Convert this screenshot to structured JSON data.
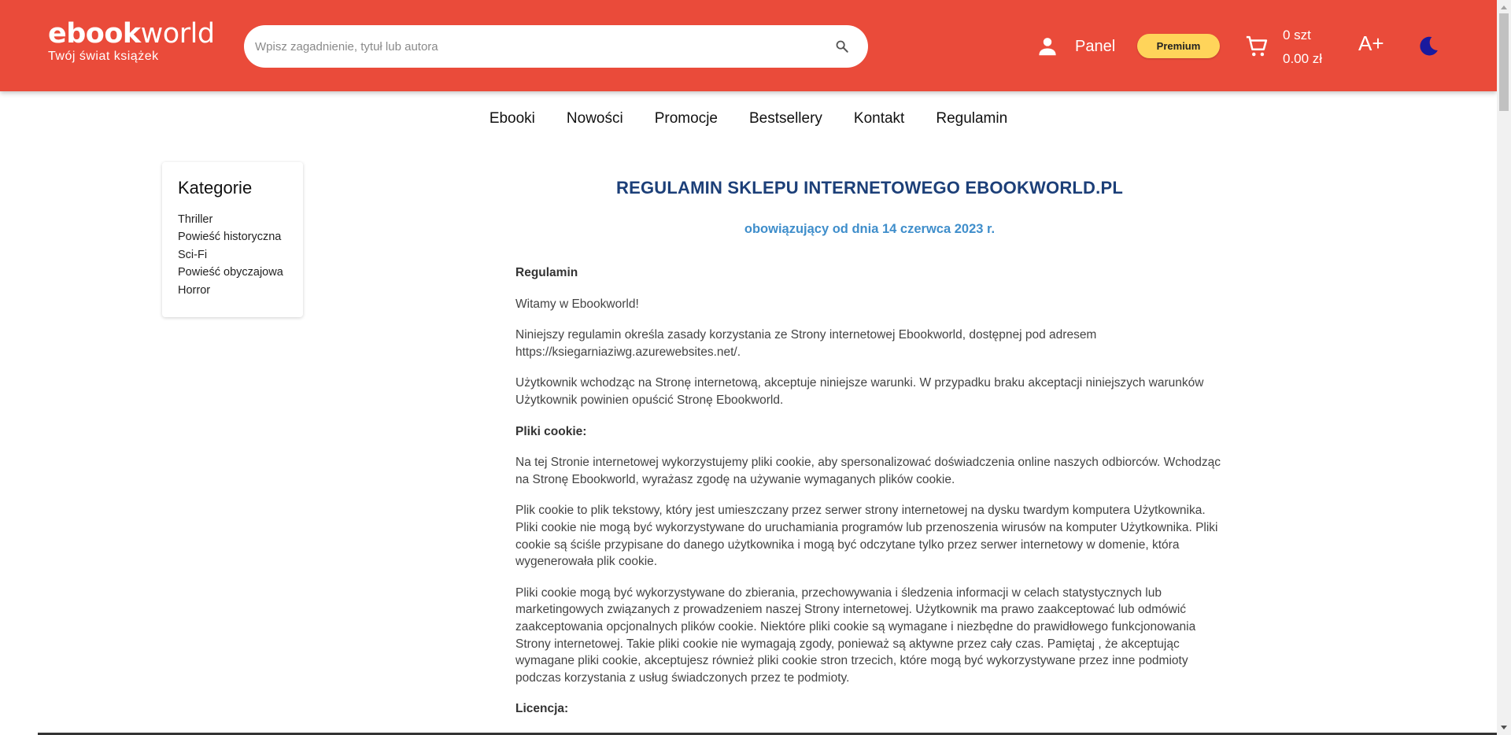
{
  "header": {
    "logo_bold": "ebook",
    "logo_light": "world",
    "tagline": "Twój świat książek",
    "search_placeholder": "Wpisz zagadnienie, tytuł lub autora",
    "panel_label": "Panel",
    "premium_label": "Premium",
    "cart_count": "0 szt",
    "cart_total": "0.00 zł",
    "font_size_label": "A+",
    "colors": {
      "bar": "#ea4b3a",
      "premium": "#ffd45a",
      "theme_icon": "#1a1a9e"
    },
    "icons": [
      "search-icon",
      "user-icon",
      "cart-icon",
      "moon-icon"
    ]
  },
  "nav": {
    "items": [
      "Ebooki",
      "Nowości",
      "Promocje",
      "Bestsellery",
      "Kontakt",
      "Regulamin"
    ]
  },
  "sidebar": {
    "title": "Kategorie",
    "items": [
      "Thriller",
      "Powieść historyczna",
      "Sci-Fi",
      "Powieść obyczajowa",
      "Horror"
    ]
  },
  "document": {
    "title": "REGULAMIN SKLEPU INTERNETOWEGO EBOOKWORLD.PL",
    "subtitle": "obowiązujący od dnia 14 czerwca 2023 r.",
    "paragraphs": [
      {
        "heading": true,
        "text": "Regulamin"
      },
      {
        "heading": false,
        "text": "Witamy w Ebookworld!"
      },
      {
        "heading": false,
        "text": "Niniejszy regulamin określa zasady korzystania ze Strony internetowej Ebookworld, dostępnej pod adresem https://ksiegarniaziwg.azurewebsites.net/."
      },
      {
        "heading": false,
        "text": "Użytkownik wchodząc na Stronę internetową, akceptuje niniejsze warunki. W przypadku braku akceptacji niniejszych warunków Użytkownik powinien opuścić Stronę Ebookworld."
      },
      {
        "heading": true,
        "text": "Pliki cookie:"
      },
      {
        "heading": false,
        "text": "Na tej Stronie internetowej wykorzystujemy pliki cookie, aby spersonalizować doświadczenia online naszych odbiorców. Wchodząc na Stronę Ebookworld, wyrażasz zgodę na używanie wymaganych plików cookie."
      },
      {
        "heading": false,
        "text": "Plik cookie to plik tekstowy, który jest umieszczany przez serwer strony internetowej na dysku twardym komputera Użytkownika. Pliki cookie nie mogą być wykorzystywane do uruchamiania programów lub przenoszenia wirusów na komputer Użytkownika. Pliki cookie są ściśle przypisane do danego użytkownika i mogą być odczytane tylko przez serwer internetowy w domenie, która wygenerowała plik cookie."
      },
      {
        "heading": false,
        "text": "Pliki cookie mogą być wykorzystywane do zbierania, przechowywania i śledzenia informacji w celach statystycznych lub marketingowych związanych z prowadzeniem naszej Strony internetowej. Użytkownik ma prawo zaakceptować lub odmówić zaakceptowania opcjonalnych plików cookie. Niektóre pliki cookie są wymagane i niezbędne do prawidłowego funkcjonowania Strony internetowej. Takie pliki cookie nie wymagają zgody, ponieważ są aktywne przez cały czas. Pamiętaj , że akceptując wymagane pliki cookie, akceptujesz również pliki cookie stron trzecich, które mogą być wykorzystywane przez inne podmioty podczas korzystania z usług świadczonych przez te podmioty."
      },
      {
        "heading": true,
        "text": "Licencja:"
      }
    ]
  }
}
